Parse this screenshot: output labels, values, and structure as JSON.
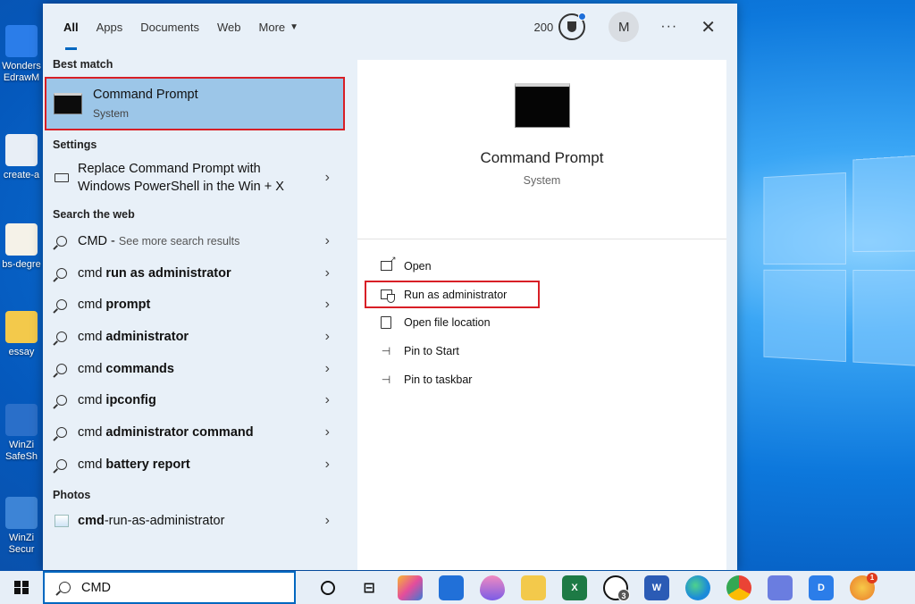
{
  "desktop": {
    "icons": [
      {
        "label_line1": "Wonders",
        "label_line2": "EdrawM",
        "icon": "edraw-icon",
        "color": "#2b7de9"
      },
      {
        "label_line1": "create-a",
        "label_line2": "",
        "icon": "document-thumbnail-icon",
        "color": "#e8eef6"
      },
      {
        "label_line1": "bs-degre",
        "label_line2": "",
        "icon": "certificate-thumbnail-icon",
        "color": "#f5f2e8"
      },
      {
        "label_line1": "essay",
        "label_line2": "",
        "icon": "folder-icon",
        "color": "#f3c94b"
      },
      {
        "label_line1": "WinZi",
        "label_line2": "SafeSh",
        "icon": "winzip-safeshare-icon",
        "color": "#2a6fc9"
      },
      {
        "label_line1": "WinZi",
        "label_line2": "Secur",
        "icon": "winzip-secure-icon",
        "color": "#3d84d6"
      }
    ]
  },
  "search_panel": {
    "tabs": [
      {
        "label": "All",
        "active": true
      },
      {
        "label": "Apps",
        "active": false
      },
      {
        "label": "Documents",
        "active": false
      },
      {
        "label": "Web",
        "active": false
      },
      {
        "label": "More",
        "active": false
      }
    ],
    "rewards_points": "200",
    "avatar_initial": "M",
    "more_options": "···",
    "close": "✕",
    "best_match_heading": "Best match",
    "best_match": {
      "title": "Command Prompt",
      "subtitle": "System"
    },
    "settings_heading": "Settings",
    "settings_item": {
      "line1": "Replace Command Prompt with",
      "line2": "Windows PowerShell in the Win + X"
    },
    "web_heading": "Search the web",
    "web_first": {
      "prefix": "CMD",
      "sep": " - ",
      "hint": "See more search results"
    },
    "web_results": [
      {
        "prefix": "cmd ",
        "bold": "run as administrator"
      },
      {
        "prefix": "cmd ",
        "bold": "prompt"
      },
      {
        "prefix": "cmd ",
        "bold": "administrator"
      },
      {
        "prefix": "cmd ",
        "bold": "commands"
      },
      {
        "prefix": "cmd ",
        "bold": "ipconfig"
      },
      {
        "prefix": "cmd ",
        "bold": "administrator command"
      },
      {
        "prefix": "cmd ",
        "bold": "battery report"
      }
    ],
    "photos_heading": "Photos",
    "photo_item": {
      "prefix": "cmd",
      "rest": "-run-as-administrator"
    },
    "preview": {
      "title": "Command Prompt",
      "subtitle": "System"
    },
    "actions": [
      {
        "label": "Open",
        "icon": "open-icon"
      },
      {
        "label": "Run as administrator",
        "icon": "admin-shield-icon"
      },
      {
        "label": "Open file location",
        "icon": "file-location-icon"
      },
      {
        "label": "Pin to Start",
        "icon": "pin-icon"
      },
      {
        "label": "Pin to taskbar",
        "icon": "pin-icon"
      }
    ]
  },
  "taskbar": {
    "search_value": "CMD",
    "whatsapp_badge": "3",
    "weather_notification": "1",
    "colors": {
      "accent": "#0067c0",
      "highlight_border": "#d81f26"
    }
  }
}
